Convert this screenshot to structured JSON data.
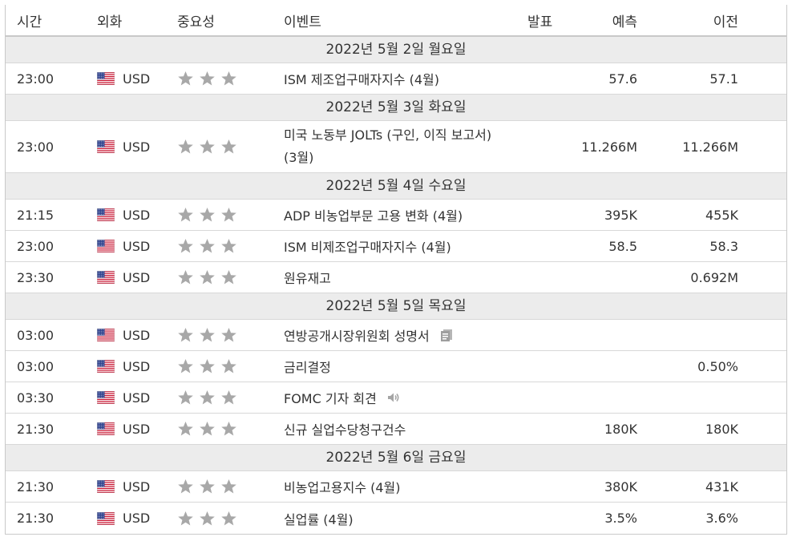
{
  "header": {
    "time": "시간",
    "currency": "외화",
    "importance": "중요성",
    "event": "이벤트",
    "actual": "발표",
    "forecast": "예측",
    "previous": "이전"
  },
  "colors": {
    "star": "#a8a8a8",
    "date_bg": "#ececec",
    "border": "#d8d8d8"
  },
  "sections": [
    {
      "date": "2022년 5월 2일 월요일",
      "events": [
        {
          "time": "23:00",
          "currency": "USD",
          "event": "ISM 제조업구매자지수 (4월)",
          "actual": "",
          "forecast": "57.6",
          "previous": "57.1",
          "stars": 3
        }
      ]
    },
    {
      "date": "2022년 5월 3일 화요일",
      "events": [
        {
          "time": "23:00",
          "currency": "USD",
          "event": "미국 노동부 JOLTs (구인, 이직 보고서) (3월)",
          "actual": "",
          "forecast": "11.266M",
          "previous": "11.266M",
          "stars": 3
        }
      ]
    },
    {
      "date": "2022년 5월 4일 수요일",
      "events": [
        {
          "time": "21:15",
          "currency": "USD",
          "event": "ADP 비농업부문 고용 변화 (4월)",
          "actual": "",
          "forecast": "395K",
          "previous": "455K",
          "stars": 3
        },
        {
          "time": "23:00",
          "currency": "USD",
          "event": "ISM 비제조업구매자지수 (4월)",
          "actual": "",
          "forecast": "58.5",
          "previous": "58.3",
          "stars": 3
        },
        {
          "time": "23:30",
          "currency": "USD",
          "event": "원유재고",
          "actual": "",
          "forecast": "",
          "previous": "0.692M",
          "stars": 3
        }
      ]
    },
    {
      "date": "2022년 5월 5일 목요일",
      "events": [
        {
          "time": "03:00",
          "currency": "USD",
          "event": "연방공개시장위원회 성명서",
          "actual": "",
          "forecast": "",
          "previous": "",
          "stars": 3,
          "icon": "document-icon"
        },
        {
          "time": "03:00",
          "currency": "USD",
          "event": "금리결정",
          "actual": "",
          "forecast": "",
          "previous": "0.50%",
          "stars": 3
        },
        {
          "time": "03:30",
          "currency": "USD",
          "event": "FOMC 기자 회견",
          "actual": "",
          "forecast": "",
          "previous": "",
          "stars": 3,
          "icon": "speaker-icon"
        },
        {
          "time": "21:30",
          "currency": "USD",
          "event": "신규 실업수당청구건수",
          "actual": "",
          "forecast": "180K",
          "previous": "180K",
          "stars": 3
        }
      ]
    },
    {
      "date": "2022년 5월 6일 금요일",
      "events": [
        {
          "time": "21:30",
          "currency": "USD",
          "event": "비농업고용지수 (4월)",
          "actual": "",
          "forecast": "380K",
          "previous": "431K",
          "stars": 3
        },
        {
          "time": "21:30",
          "currency": "USD",
          "event": "실업률 (4월)",
          "actual": "",
          "forecast": "3.5%",
          "previous": "3.6%",
          "stars": 3
        }
      ]
    }
  ]
}
